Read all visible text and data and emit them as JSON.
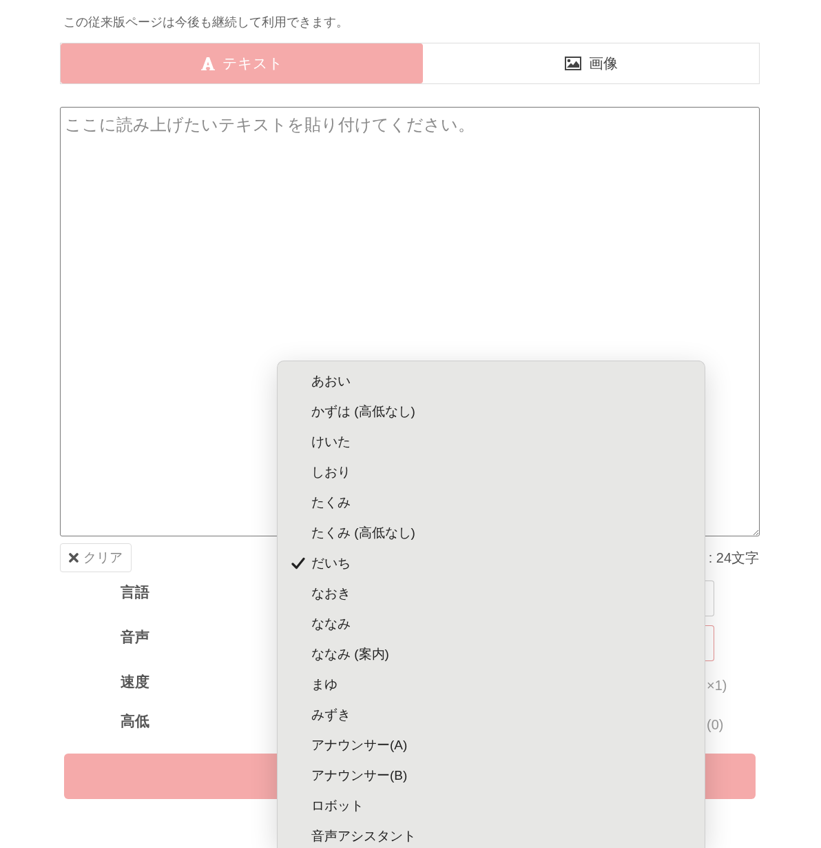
{
  "notice": "この従来版ページは今後も継続して利用できます。",
  "tabs": [
    {
      "kind": "text",
      "label": "テキスト",
      "selected": true
    },
    {
      "kind": "image",
      "label": "画像",
      "selected": false
    }
  ],
  "editor": {
    "placeholder": "ここに読み上げたいテキストを貼り付けてください。"
  },
  "clear_button": {
    "label": "クリア"
  },
  "char_count": ": 24文字",
  "settings": [
    {
      "label": "言語",
      "kind": "select",
      "focused": false
    },
    {
      "label": "音声",
      "kind": "select",
      "focused": true
    },
    {
      "label": "速度",
      "kind": "reading",
      "reading": "×1)"
    },
    {
      "label": "高低",
      "kind": "reading",
      "reading": "(0)"
    }
  ],
  "voice_menu": {
    "items": [
      {
        "label": "あおい",
        "selected": false
      },
      {
        "label": "かずは (高低なし)",
        "selected": false
      },
      {
        "label": "けいた",
        "selected": false
      },
      {
        "label": "しおり",
        "selected": false
      },
      {
        "label": "たくみ",
        "selected": false
      },
      {
        "label": "たくみ (高低なし)",
        "selected": false
      },
      {
        "label": "だいち",
        "selected": true
      },
      {
        "label": "なおき",
        "selected": false
      },
      {
        "label": "ななみ",
        "selected": false
      },
      {
        "label": "ななみ (案内)",
        "selected": false
      },
      {
        "label": "まゆ",
        "selected": false
      },
      {
        "label": "みずき",
        "selected": false
      },
      {
        "label": "アナウンサー(A)",
        "selected": false
      },
      {
        "label": "アナウンサー(B)",
        "selected": false
      },
      {
        "label": "ロボット",
        "selected": false
      },
      {
        "label": "音声アシスタント",
        "selected": false
      }
    ]
  }
}
